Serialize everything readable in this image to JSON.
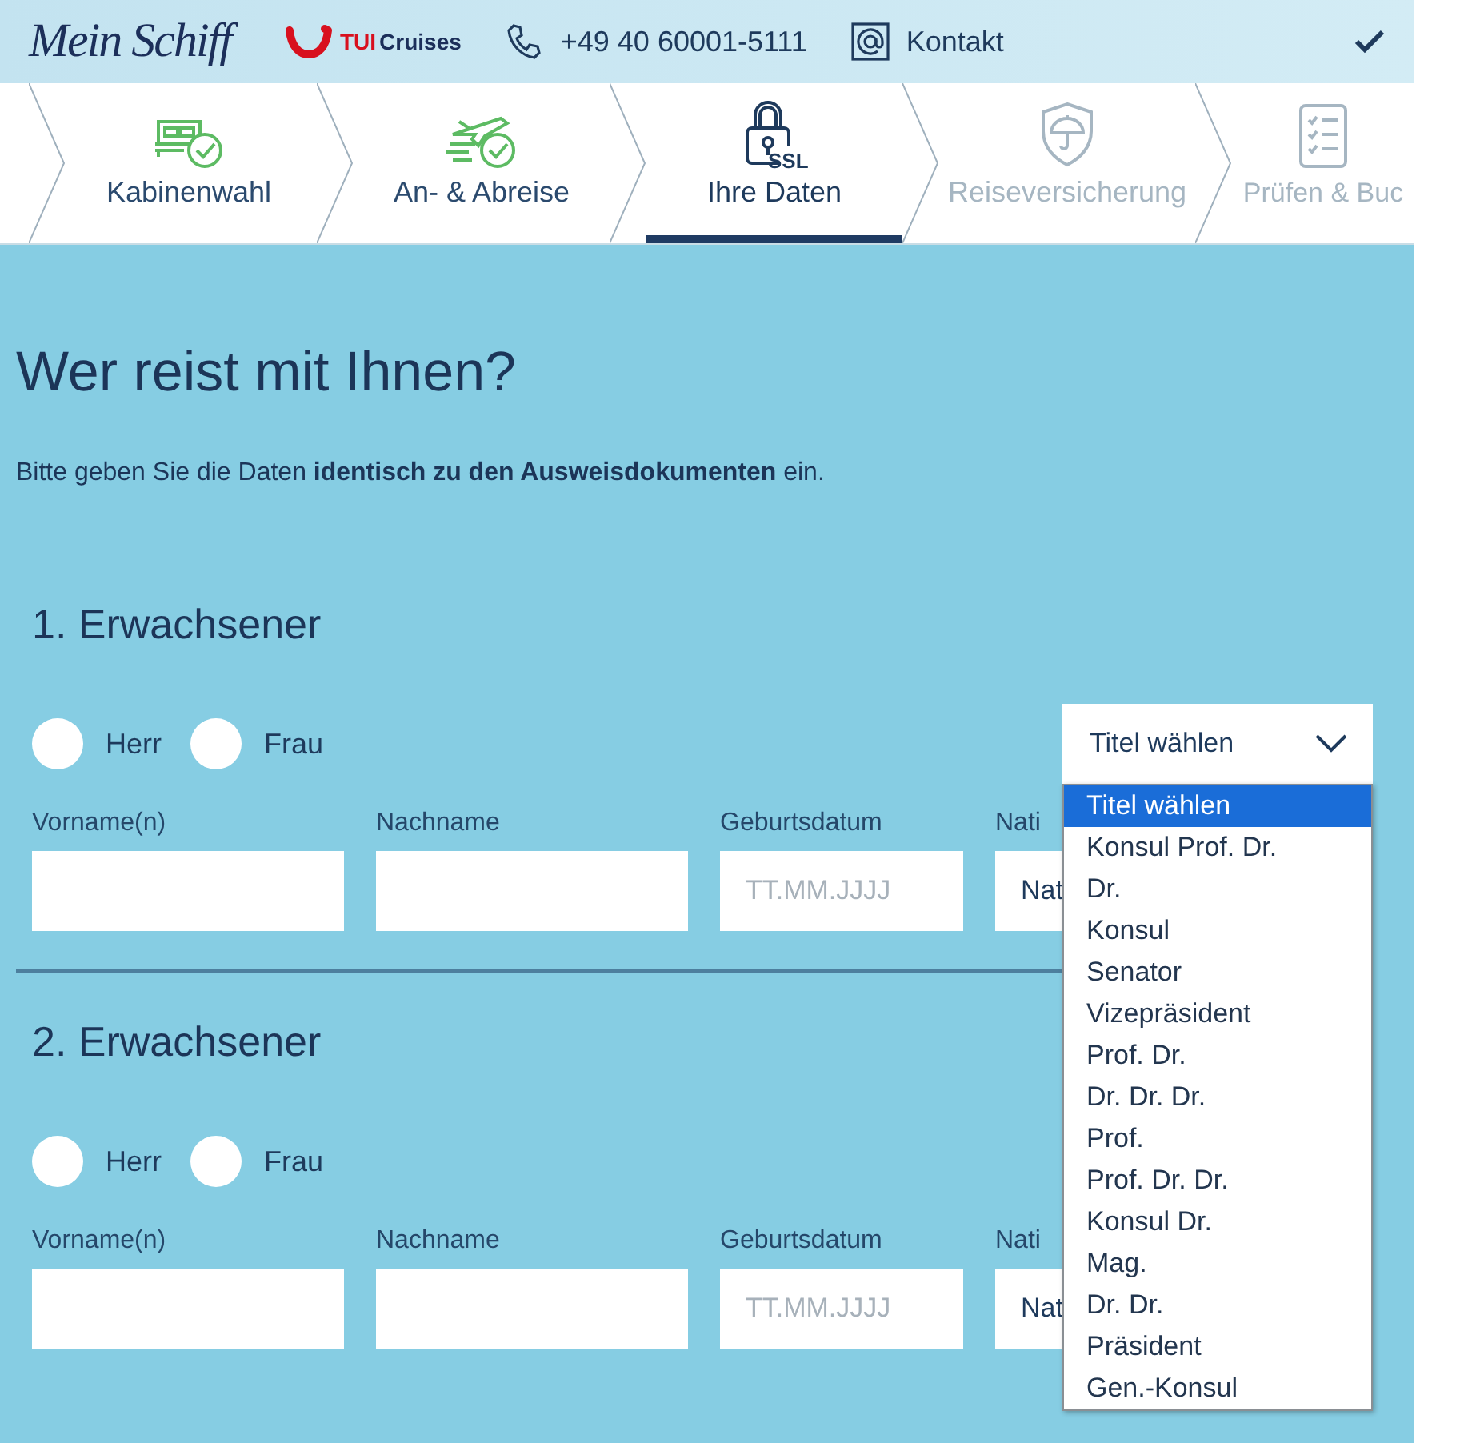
{
  "header": {
    "brand": "Mein Schiff",
    "partner_brand": {
      "part1": "TUI",
      "part2": "Cruises"
    },
    "phone": "+49 40 60001-5111",
    "contact": "Kontakt"
  },
  "steps": [
    {
      "label": "Kabinenwahl",
      "completed": true,
      "selected": false
    },
    {
      "label": "An- & Abreise",
      "completed": true,
      "selected": false
    },
    {
      "label": "Ihre Daten",
      "icon_badge": "SSL",
      "completed": false,
      "selected": true
    },
    {
      "label": "Reiseversicherung",
      "completed": false,
      "selected": false
    },
    {
      "label": "Prüfen & Buc",
      "completed": false,
      "selected": false
    }
  ],
  "page": {
    "title": "Wer reist mit Ihnen?",
    "intro": "Bitte geben Sie die Daten **identisch zu den Ausweisdokumenten** ein."
  },
  "travellers": [
    {
      "heading": "1. Erwachsener",
      "salutations": [
        {
          "label": "Herr",
          "selected": false
        },
        {
          "label": "Frau",
          "selected": false
        }
      ],
      "title_select": {
        "value": "Titel wählen",
        "expanded": true,
        "options": [
          {
            "label": "Titel wählen",
            "selected": true
          },
          {
            "label": "Konsul Prof. Dr.",
            "selected": false
          },
          {
            "label": "Dr.",
            "selected": false
          },
          {
            "label": "Konsul",
            "selected": false
          },
          {
            "label": "Senator",
            "selected": false
          },
          {
            "label": "Vizepräsident",
            "selected": false
          },
          {
            "label": "Prof. Dr.",
            "selected": false
          },
          {
            "label": "Dr. Dr. Dr.",
            "selected": false
          },
          {
            "label": "Prof.",
            "selected": false
          },
          {
            "label": "Prof. Dr. Dr.",
            "selected": false
          },
          {
            "label": "Konsul Dr.",
            "selected": false
          },
          {
            "label": "Mag.",
            "selected": false
          },
          {
            "label": "Dr. Dr.",
            "selected": false
          },
          {
            "label": "Präsident",
            "selected": false
          },
          {
            "label": "Gen.-Konsul",
            "selected": false
          }
        ]
      },
      "fields": [
        {
          "label": "Vorname(n)"
        },
        {
          "label": "Nachname"
        },
        {
          "label": "Geburtsdatum",
          "placeholder": "TT.MM.JJJJ"
        },
        {
          "label": "Nati",
          "value": "Nat"
        }
      ]
    },
    {
      "heading": "2. Erwachsener",
      "salutations": [
        {
          "label": "Herr",
          "selected": false
        },
        {
          "label": "Frau",
          "selected": false
        }
      ],
      "fields": [
        {
          "label": "Vorname(n)"
        },
        {
          "label": "Nachname"
        },
        {
          "label": "Geburtsdatum",
          "placeholder": "TT.MM.JJJJ"
        },
        {
          "label": "Nati",
          "value": "Nat"
        }
      ]
    }
  ]
}
